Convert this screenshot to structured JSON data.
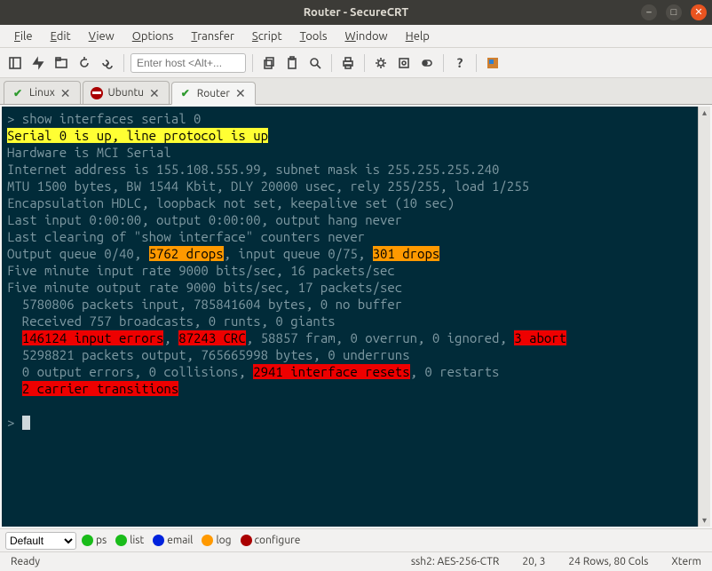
{
  "window": {
    "title": "Router - SecureCRT"
  },
  "menubar": {
    "items": [
      "File",
      "Edit",
      "View",
      "Options",
      "Transfer",
      "Script",
      "Tools",
      "Window",
      "Help"
    ]
  },
  "toolbar": {
    "host_placeholder": "Enter host <Alt+..."
  },
  "tabs": {
    "items": [
      {
        "label": "Linux",
        "status": "check",
        "active": false
      },
      {
        "label": "Ubuntu",
        "status": "nosym",
        "active": false
      },
      {
        "label": "Router",
        "status": "check",
        "active": true
      }
    ]
  },
  "terminal": {
    "lines": [
      {
        "seg": [
          {
            "t": "> show interfaces serial 0"
          }
        ]
      },
      {
        "seg": [
          {
            "t": "Serial 0 is up, line protocol is up",
            "c": "hl-yellow"
          }
        ]
      },
      {
        "seg": [
          {
            "t": "Hardware is MCI Serial"
          }
        ]
      },
      {
        "seg": [
          {
            "t": "Internet address is 155.108.555.99, subnet mask is 255.255.255.240"
          }
        ]
      },
      {
        "seg": [
          {
            "t": "MTU 1500 bytes, BW 1544 Kbit, DLY 20000 usec, rely 255/255, load 1/255"
          }
        ]
      },
      {
        "seg": [
          {
            "t": "Encapsulation HDLC, loopback not set, keepalive set (10 sec)"
          }
        ]
      },
      {
        "seg": [
          {
            "t": "Last input 0:00:00, output 0:00:00, output hang never"
          }
        ]
      },
      {
        "seg": [
          {
            "t": "Last clearing of \"show interface\" counters never"
          }
        ]
      },
      {
        "seg": [
          {
            "t": "Output queue 0/40, "
          },
          {
            "t": "5762 drops",
            "c": "hl-orange"
          },
          {
            "t": ", input queue 0/75, "
          },
          {
            "t": "301 drops",
            "c": "hl-orange"
          }
        ]
      },
      {
        "seg": [
          {
            "t": "Five minute input rate 9000 bits/sec, 16 packets/sec"
          }
        ]
      },
      {
        "seg": [
          {
            "t": "Five minute output rate 9000 bits/sec, 17 packets/sec"
          }
        ]
      },
      {
        "seg": [
          {
            "t": "  5780806 packets input, 785841604 bytes, 0 no buffer"
          }
        ]
      },
      {
        "seg": [
          {
            "t": "  Received 757 broadcasts, 0 runts, 0 giants"
          }
        ]
      },
      {
        "seg": [
          {
            "t": "  "
          },
          {
            "t": "146124 input errors",
            "c": "hl-red"
          },
          {
            "t": ", "
          },
          {
            "t": "87243 CRC",
            "c": "hl-red"
          },
          {
            "t": ", 58857 fram, 0 overrun, 0 ignored, "
          },
          {
            "t": "3 abort",
            "c": "hl-red"
          }
        ]
      },
      {
        "seg": [
          {
            "t": "  5298821 packets output, 765665998 bytes, 0 underruns"
          }
        ]
      },
      {
        "seg": [
          {
            "t": "  0 output errors, 0 collisions, "
          },
          {
            "t": "2941 interface resets",
            "c": "hl-red"
          },
          {
            "t": ", 0 restarts"
          }
        ]
      },
      {
        "seg": [
          {
            "t": "  "
          },
          {
            "t": "2 carrier transitions",
            "c": "hl-red"
          }
        ]
      },
      {
        "seg": [
          {
            "t": ""
          }
        ]
      },
      {
        "seg": [
          {
            "t": "> "
          }
        ],
        "cursor_after": true
      }
    ]
  },
  "bottombar": {
    "select": "Default",
    "buttons": [
      {
        "label": "ps",
        "color": "#1abc1a"
      },
      {
        "label": "list",
        "color": "#1abc1a"
      },
      {
        "label": "email",
        "color": "#0022dd"
      },
      {
        "label": "log",
        "color": "#ff9900"
      },
      {
        "label": "configure",
        "color": "#aa0000"
      }
    ]
  },
  "statusbar": {
    "ready": "Ready",
    "ssh": "ssh2: AES-256-CTR",
    "cursor": "20,   3",
    "dims": "24 Rows, 80 Cols",
    "tt": "Xterm"
  }
}
